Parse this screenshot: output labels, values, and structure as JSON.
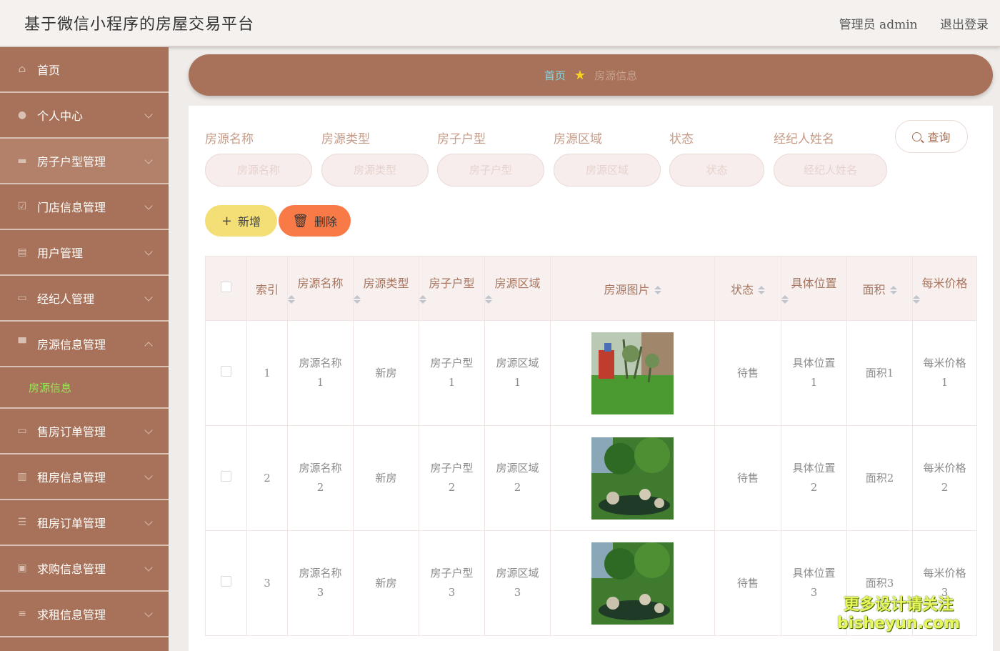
{
  "header": {
    "title": "基于微信小程序的房屋交易平台",
    "admin_label": "管理员 admin",
    "logout_label": "退出登录"
  },
  "sidebar": {
    "items": [
      {
        "label": "首页",
        "icon": "home-icon"
      },
      {
        "label": "个人中心",
        "icon": "user-icon"
      },
      {
        "label": "房子户型管理",
        "icon": "briefcase-icon"
      },
      {
        "label": "门店信息管理",
        "icon": "check-square-icon"
      },
      {
        "label": "用户管理",
        "icon": "chat-icon"
      },
      {
        "label": "经纪人管理",
        "icon": "monitor-icon"
      },
      {
        "label": "房源信息管理",
        "icon": "presentation-icon"
      },
      {
        "label": "售房订单管理",
        "icon": "laptop-icon"
      },
      {
        "label": "租房信息管理",
        "icon": "books-icon"
      },
      {
        "label": "租房订单管理",
        "icon": "list-icon"
      },
      {
        "label": "求购信息管理",
        "icon": "clipboard-icon"
      },
      {
        "label": "求租信息管理",
        "icon": "sliders-icon"
      }
    ],
    "submenu": {
      "label": "房源信息"
    }
  },
  "breadcrumb": {
    "home": "首页",
    "current": "房源信息"
  },
  "filters": [
    {
      "label": "房源名称",
      "placeholder": "房源名称"
    },
    {
      "label": "房源类型",
      "placeholder": "房源类型"
    },
    {
      "label": "房子户型",
      "placeholder": "房子户型"
    },
    {
      "label": "房源区域",
      "placeholder": "房源区域"
    },
    {
      "label": "状态",
      "placeholder": "状态"
    },
    {
      "label": "经纪人姓名",
      "placeholder": "经纪人姓名"
    }
  ],
  "buttons": {
    "query": "查询",
    "add": "新增",
    "delete": "删除"
  },
  "table": {
    "columns": [
      "索引",
      "房源名称",
      "房源类型",
      "房子户型",
      "房源区域",
      "房源图片",
      "状态",
      "具体位置",
      "面积",
      "每米价格"
    ],
    "rows": [
      {
        "index": "1",
        "name_a": "房源名称",
        "name_b": "1",
        "type": "新房",
        "layout_a": "房子户型",
        "layout_b": "1",
        "area_a": "房源区域",
        "area_b": "1",
        "status": "待售",
        "loc_a": "具体位置",
        "loc_b": "1",
        "size": "面积1",
        "price_a": "每米价格",
        "price_b": "1"
      },
      {
        "index": "2",
        "name_a": "房源名称",
        "name_b": "2",
        "type": "新房",
        "layout_a": "房子户型",
        "layout_b": "2",
        "area_a": "房源区域",
        "area_b": "2",
        "status": "待售",
        "loc_a": "具体位置",
        "loc_b": "2",
        "size": "面积2",
        "price_a": "每米价格",
        "price_b": "2"
      },
      {
        "index": "3",
        "name_a": "房源名称",
        "name_b": "3",
        "type": "新房",
        "layout_a": "房子户型",
        "layout_b": "3",
        "area_a": "房源区域",
        "area_b": "3",
        "status": "待售",
        "loc_a": "具体位置",
        "loc_b": "3",
        "size": "面积3",
        "price_a": "每米价格",
        "price_b": "3"
      }
    ]
  },
  "watermark": {
    "line1": "更多设计请关注",
    "line2": "bisheyun.com"
  },
  "colors": {
    "sidebar": "#a77259",
    "accent_green": "#9be45a",
    "add_button": "#f3df76",
    "delete_button": "#f87b47"
  }
}
